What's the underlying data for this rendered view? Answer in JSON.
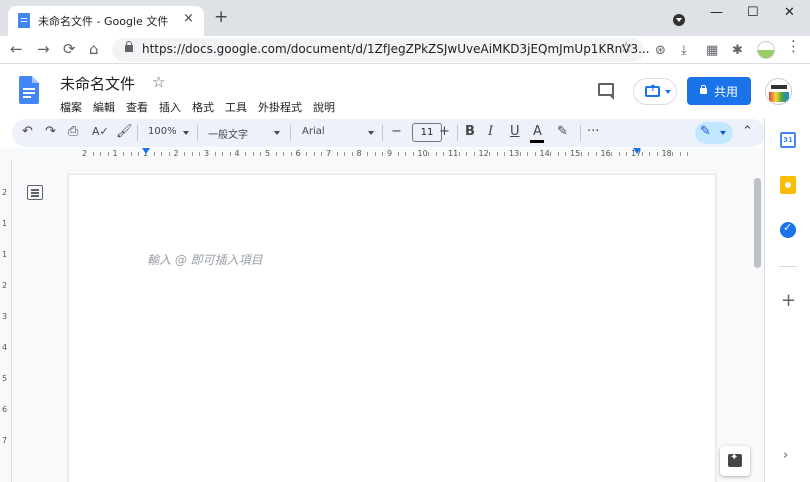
{
  "browser": {
    "tab_title": "未命名文件 - Google 文件",
    "tab_close": "×",
    "new_tab": "+",
    "url": "https://docs.google.com/document/d/1ZfJegZPkZSJwUveAiMKD3jEQmJmUp1KRnV3...",
    "nav": {
      "back": "←",
      "forward": "→",
      "reload": "⟳",
      "home": "⌂"
    },
    "window": {
      "minimize": "—",
      "maximize": "☐",
      "close": "✕"
    },
    "extensions": [
      "⊛",
      "⤓",
      "▦",
      "✱"
    ]
  },
  "docs": {
    "title": "未命名文件",
    "star": "☆",
    "menu": [
      "檔案",
      "編輯",
      "查看",
      "插入",
      "格式",
      "工具",
      "外掛程式",
      "說明"
    ],
    "share_label": "共用",
    "toolbar": {
      "zoom": "100%",
      "style": "一般文字",
      "font": "Arial",
      "font_size": "11",
      "minus": "−",
      "plus": "+",
      "bold": "B",
      "italic": "I",
      "underline": "U",
      "text_color": "A",
      "more": "···",
      "undo": "↶",
      "redo": "↷",
      "collapse": "⌃"
    },
    "placeholder": "輸入 @ 即可插入項目",
    "ruler_numbers": [
      "2",
      "1",
      "1",
      "2",
      "3",
      "4",
      "5",
      "6",
      "7",
      "8",
      "9",
      "10",
      "11",
      "12",
      "13",
      "14",
      "15",
      "16",
      "17",
      "18"
    ],
    "vruler_numbers": [
      "2",
      "1",
      "1",
      "2",
      "3",
      "4",
      "5",
      "6",
      "7"
    ],
    "side_panel": {
      "calendar_label": "31",
      "add": "+",
      "expand": "›"
    }
  },
  "colors": {
    "accent": "#1a73e8",
    "docs_blue": "#4285f4",
    "keep_yellow": "#fbbc04"
  }
}
